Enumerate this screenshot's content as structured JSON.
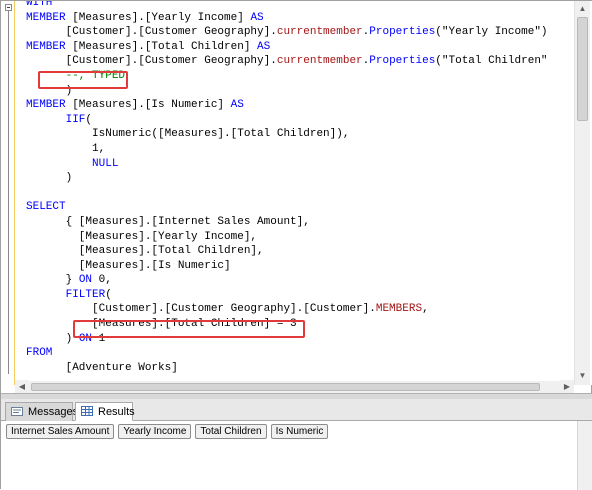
{
  "editor": {
    "lines": [
      [
        {
          "t": "WITH",
          "c": "kw"
        }
      ],
      [
        {
          "t": "MEMBER",
          "c": "kw"
        },
        {
          "t": " [Measures].[Yearly Income] "
        },
        {
          "t": "AS",
          "c": "kw"
        }
      ],
      [
        {
          "t": "      [Customer].[Customer Geography]."
        },
        {
          "t": "currentmember",
          "c": "fn"
        },
        {
          "t": "."
        },
        {
          "t": "Properties",
          "c": "kw"
        },
        {
          "t": "(\"Yearly Income\")"
        }
      ],
      [
        {
          "t": "MEMBER",
          "c": "kw"
        },
        {
          "t": " [Measures].[Total Children] "
        },
        {
          "t": "AS",
          "c": "kw"
        }
      ],
      [
        {
          "t": "      [Customer].[Customer Geography]."
        },
        {
          "t": "currentmember",
          "c": "fn"
        },
        {
          "t": "."
        },
        {
          "t": "Properties",
          "c": "kw"
        },
        {
          "t": "(\"Total Children\""
        }
      ],
      [
        {
          "t": "      "
        },
        {
          "t": "--, TYPED",
          "c": "cm"
        }
      ],
      [
        {
          "t": "      )"
        }
      ],
      [
        {
          "t": "MEMBER",
          "c": "kw"
        },
        {
          "t": " [Measures].[Is Numeric] "
        },
        {
          "t": "AS",
          "c": "kw"
        }
      ],
      [
        {
          "t": "      "
        },
        {
          "t": "IIF",
          "c": "kw"
        },
        {
          "t": "("
        }
      ],
      [
        {
          "t": "          IsNumeric([Measures].[Total Children]),"
        }
      ],
      [
        {
          "t": "          1,"
        }
      ],
      [
        {
          "t": "          "
        },
        {
          "t": "NULL",
          "c": "kw"
        }
      ],
      [
        {
          "t": "      )"
        }
      ],
      [
        {
          "t": ""
        }
      ],
      [
        {
          "t": "SELECT",
          "c": "kw"
        }
      ],
      [
        {
          "t": "      { [Measures].[Internet Sales Amount],"
        }
      ],
      [
        {
          "t": "        [Measures].[Yearly Income],"
        }
      ],
      [
        {
          "t": "        [Measures].[Total Children],"
        }
      ],
      [
        {
          "t": "        [Measures].[Is Numeric]"
        }
      ],
      [
        {
          "t": "      } "
        },
        {
          "t": "ON",
          "c": "kw"
        },
        {
          "t": " 0,"
        }
      ],
      [
        {
          "t": "      "
        },
        {
          "t": "FILTER",
          "c": "kw"
        },
        {
          "t": "("
        }
      ],
      [
        {
          "t": "          [Customer].[Customer Geography].[Customer]."
        },
        {
          "t": "MEMBERS",
          "c": "fn"
        },
        {
          "t": ","
        }
      ],
      [
        {
          "t": "          [Measures].[Total Children] = 3"
        }
      ],
      [
        {
          "t": "      ) "
        },
        {
          "t": "ON",
          "c": "kw"
        },
        {
          "t": " 1"
        }
      ],
      [
        {
          "t": "FROM",
          "c": "kw"
        }
      ],
      [
        {
          "t": "      [Adventure Works]"
        }
      ]
    ]
  },
  "tabs": [
    {
      "label": "Messages",
      "icon": "messages-icon",
      "active": false
    },
    {
      "label": "Results",
      "icon": "results-grid-icon",
      "active": true
    }
  ],
  "results": {
    "columns": [
      "Internet Sales Amount",
      "Yearly Income",
      "Total Children",
      "Is Numeric"
    ]
  },
  "colors": {
    "keyword": "#0000ff",
    "function": "#a31515",
    "comment": "#008000",
    "highlight": "#e03a3a"
  }
}
